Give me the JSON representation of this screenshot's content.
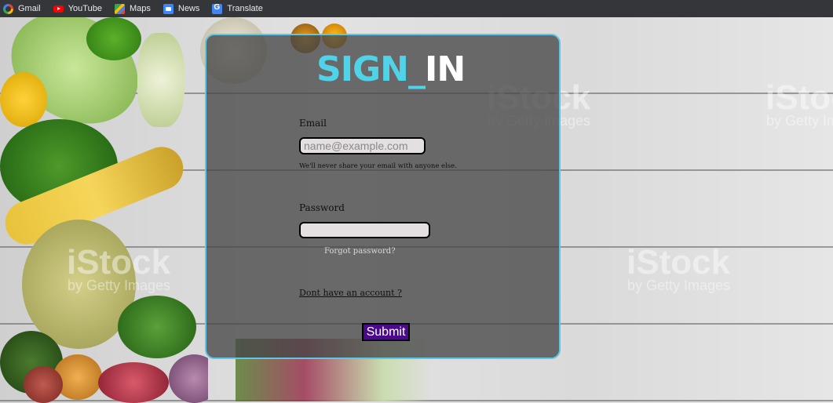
{
  "bookmarks": [
    {
      "label": "Gmail",
      "icon": "google-icon"
    },
    {
      "label": "YouTube",
      "icon": "youtube-icon"
    },
    {
      "label": "Maps",
      "icon": "maps-icon"
    },
    {
      "label": "News",
      "icon": "news-icon"
    },
    {
      "label": "Translate",
      "icon": "translate-icon"
    }
  ],
  "form": {
    "title_part1": "SIGN_",
    "title_part2": "IN",
    "email_label": "Email",
    "email_placeholder": "name@example.com",
    "email_value": "",
    "email_help": "We'll never share your email with anyone else.",
    "password_label": "Password",
    "password_value": "",
    "forgot_label": "Forgot password?",
    "signup_label": "Dont have an account ?",
    "submit_label": "Submit"
  },
  "watermarks": [
    {
      "brand": "iStock",
      "tag": "by Getty Images"
    }
  ],
  "colors": {
    "title_accent": "#4fd3e8",
    "panel_border": "#5bc8ea",
    "submit_bg": "#4a0a8a",
    "bookmark_bar": "#35363a"
  }
}
